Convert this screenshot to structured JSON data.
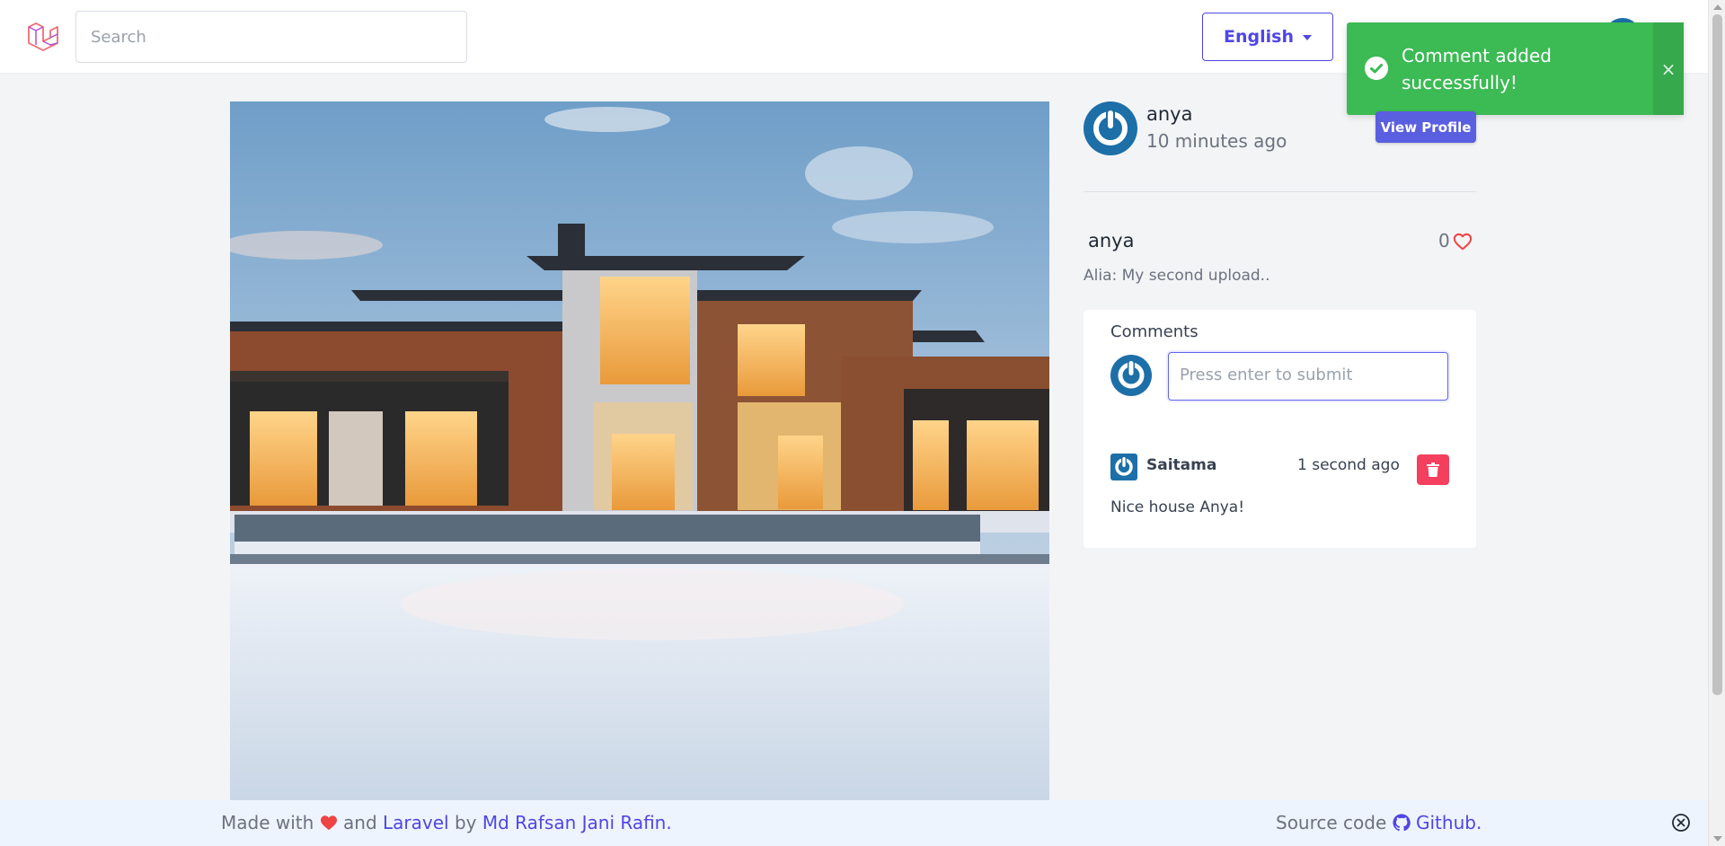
{
  "nav": {
    "search_placeholder": "Search",
    "language_label": "English",
    "logo_icon": "laravel-logo-icon"
  },
  "toast": {
    "message": "Comment added successfully!",
    "close_symbol": "×",
    "color": "#3cba54"
  },
  "post": {
    "author": "anya",
    "time": "10 minutes ago",
    "view_profile_label": "View Profile",
    "title": "anya",
    "likes": "0",
    "caption": "Alia: My second upload.."
  },
  "comments": {
    "title": "Comments",
    "input_placeholder": "Press enter to submit",
    "items": [
      {
        "author": "Saitama",
        "time": "1 second ago",
        "text": "Nice house Anya!"
      }
    ]
  },
  "footer": {
    "made_with": "Made with",
    "and": "and",
    "laravel": "Laravel",
    "by": "by",
    "author": "Md Rafsan Jani Rafin.",
    "source_code": "Source code",
    "github": "Github."
  },
  "colors": {
    "accent": "#4f46e5",
    "button": "#5a5fe0",
    "danger": "#f43f5e",
    "heart": "#ef4444"
  }
}
